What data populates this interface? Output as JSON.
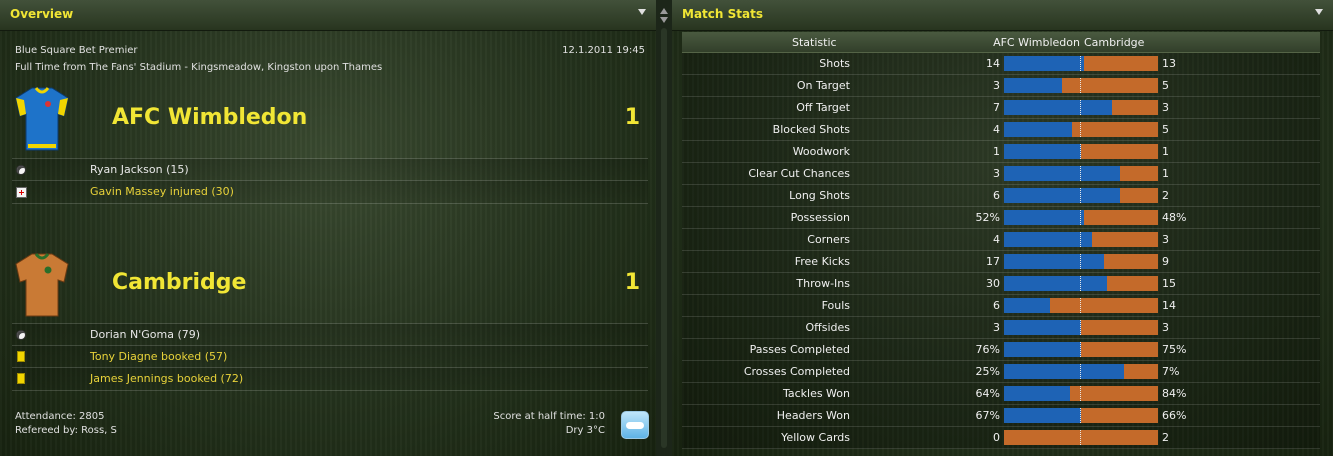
{
  "overview": {
    "title": "Overview",
    "competition": "Blue Square Bet Premier",
    "datetime": "12.1.2011 19:45",
    "venue": "Full Time from The Fans' Stadium - Kingsmeadow, Kingston upon Thames",
    "home": {
      "name": "AFC Wimbledon",
      "score": "1",
      "shirt_color": "#1e73c9",
      "events": [
        {
          "icon": "goal-ball-icon",
          "text": "Ryan Jackson (15)",
          "color": "white"
        },
        {
          "icon": "injury-icon",
          "text": "Gavin Massey injured (30)",
          "color": "yellow"
        }
      ]
    },
    "away": {
      "name": "Cambridge",
      "score": "1",
      "shirt_color": "#c97a35",
      "events": [
        {
          "icon": "goal-ball-icon",
          "text": "Dorian N'Goma (79)",
          "color": "white"
        },
        {
          "icon": "yellow-card-icon",
          "text": "Tony Diagne booked (57)",
          "color": "yellow"
        },
        {
          "icon": "yellow-card-icon",
          "text": "James Jennings booked (72)",
          "color": "yellow"
        }
      ]
    },
    "attendance": "Attendance: 2805",
    "referee": "Refereed by: Ross, S",
    "halftime": "Score at half time: 1:0",
    "weather": "Dry 3°C"
  },
  "stats": {
    "title": "Match Stats",
    "headers": {
      "statistic": "Statistic",
      "home": "AFC Wimbledon",
      "away": "Cambridge"
    },
    "colors": {
      "home": "#1e63b5",
      "away": "#c46a2a"
    },
    "rows": [
      {
        "label": "Shots",
        "home": "14",
        "away": "13",
        "home_share": 0.52
      },
      {
        "label": "On Target",
        "home": "3",
        "away": "5",
        "home_share": 0.375
      },
      {
        "label": "Off Target",
        "home": "7",
        "away": "3",
        "home_share": 0.7
      },
      {
        "label": "Blocked Shots",
        "home": "4",
        "away": "5",
        "home_share": 0.44
      },
      {
        "label": "Woodwork",
        "home": "1",
        "away": "1",
        "home_share": 0.5
      },
      {
        "label": "Clear Cut Chances",
        "home": "3",
        "away": "1",
        "home_share": 0.75
      },
      {
        "label": "Long Shots",
        "home": "6",
        "away": "2",
        "home_share": 0.75
      },
      {
        "label": "Possession",
        "home": "52%",
        "away": "48%",
        "home_share": 0.52
      },
      {
        "label": "Corners",
        "home": "4",
        "away": "3",
        "home_share": 0.57
      },
      {
        "label": "Free Kicks",
        "home": "17",
        "away": "9",
        "home_share": 0.65
      },
      {
        "label": "Throw-Ins",
        "home": "30",
        "away": "15",
        "home_share": 0.67
      },
      {
        "label": "Fouls",
        "home": "6",
        "away": "14",
        "home_share": 0.3
      },
      {
        "label": "Offsides",
        "home": "3",
        "away": "3",
        "home_share": 0.5
      },
      {
        "label": "Passes Completed",
        "home": "76%",
        "away": "75%",
        "home_share": 0.5
      },
      {
        "label": "Crosses Completed",
        "home": "25%",
        "away": "7%",
        "home_share": 0.78
      },
      {
        "label": "Tackles Won",
        "home": "64%",
        "away": "84%",
        "home_share": 0.43
      },
      {
        "label": "Headers Won",
        "home": "67%",
        "away": "66%",
        "home_share": 0.5
      },
      {
        "label": "Yellow Cards",
        "home": "0",
        "away": "2",
        "home_share": 0.0
      }
    ]
  }
}
